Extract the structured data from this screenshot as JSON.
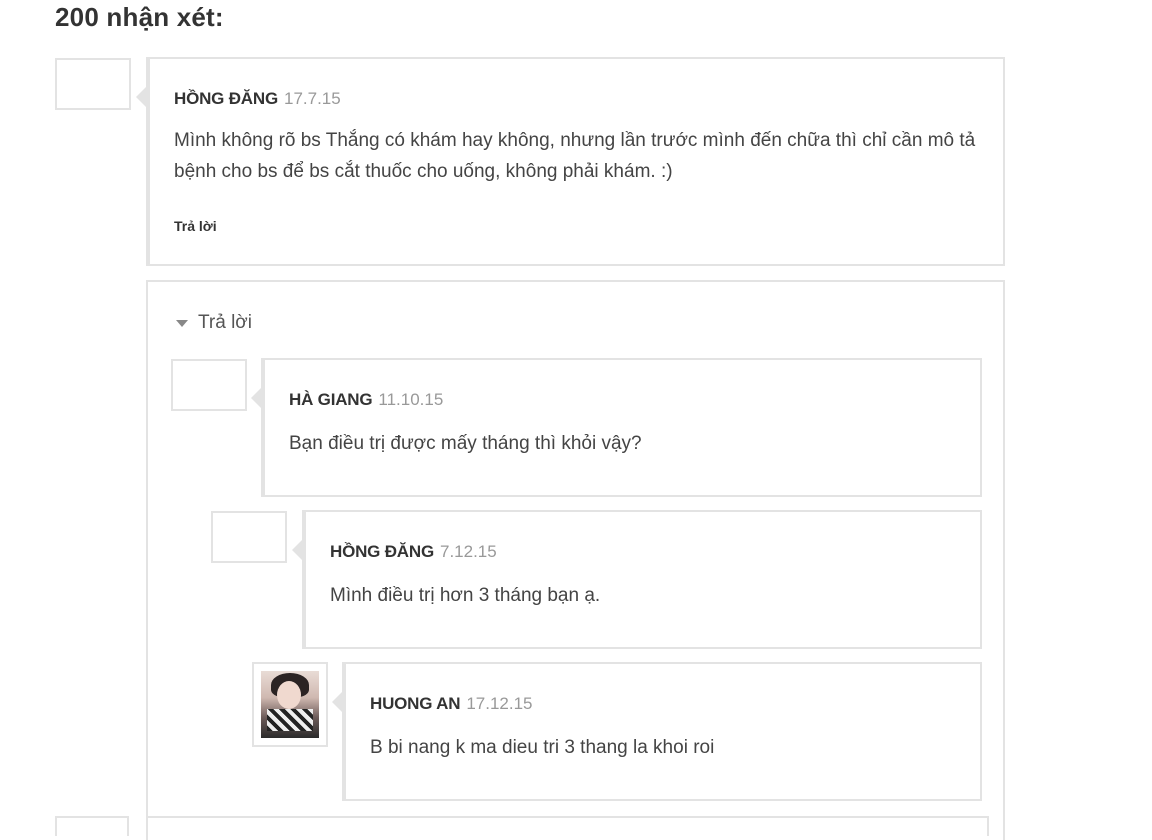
{
  "heading": "200 nhận xét:",
  "top_comment": {
    "author": "HỒNG ĐĂNG",
    "date": "17.7.15",
    "text": "Mình không rõ bs Thắng có khám hay không, nhưng lần trước mình đến chữa thì chỉ cần mô tả bệnh cho bs để bs cắt thuốc cho uống, không phải khám. :)",
    "reply_label": "Trả lời"
  },
  "thread": {
    "toggle_label": "Trả lời",
    "replies": [
      {
        "author": "HÀ GIANG",
        "date": "11.10.15",
        "text": "Bạn điều trị được mấy tháng thì khỏi vậy?"
      },
      {
        "author": "HỒNG ĐĂNG",
        "date": "7.12.15",
        "text": "Mình điều trị hơn 3 tháng bạn ạ."
      },
      {
        "author": "HUONG AN",
        "date": "17.12.15",
        "text": "B bi nang k ma dieu tri 3 thang la khoi roi"
      }
    ]
  },
  "colors": {
    "border": "#e3e3e3",
    "date": "#999999",
    "text": "#444444"
  }
}
